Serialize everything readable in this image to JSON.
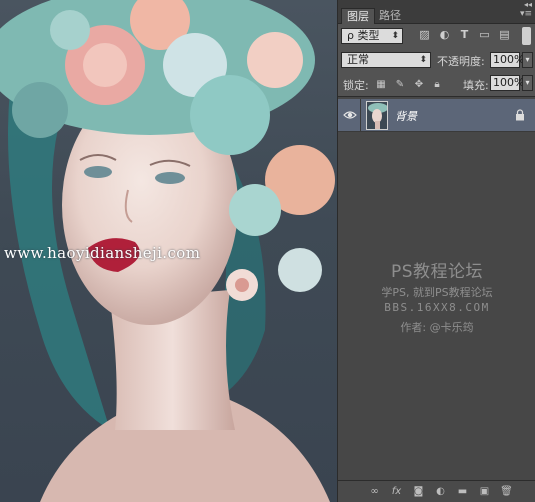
{
  "canvas": {
    "watermark_url": "www.haoyidiansheji.com"
  },
  "panel": {
    "tabs": [
      {
        "label": "图层",
        "active": true
      },
      {
        "label": "路径",
        "active": false
      }
    ],
    "filter": {
      "label": "ρ 类型"
    },
    "blend_mode": "正常",
    "opacity_label": "不透明度:",
    "opacity_value": "100%",
    "lock_label": "锁定:",
    "fill_label": "填充:",
    "fill_value": "100%",
    "layers": [
      {
        "name": "背景",
        "visible": true,
        "locked": true,
        "selected": true
      }
    ],
    "watermark": {
      "title": "PS教程论坛",
      "line1": "学PS, 就到PS教程论坛",
      "line2": "BBS.16XX8.COM",
      "line3": "作者: @卡乐筠"
    }
  },
  "colors": {
    "panel_bg": "#535353",
    "selected_layer": "#5c6678",
    "tab_bar": "#3c3c3c"
  }
}
